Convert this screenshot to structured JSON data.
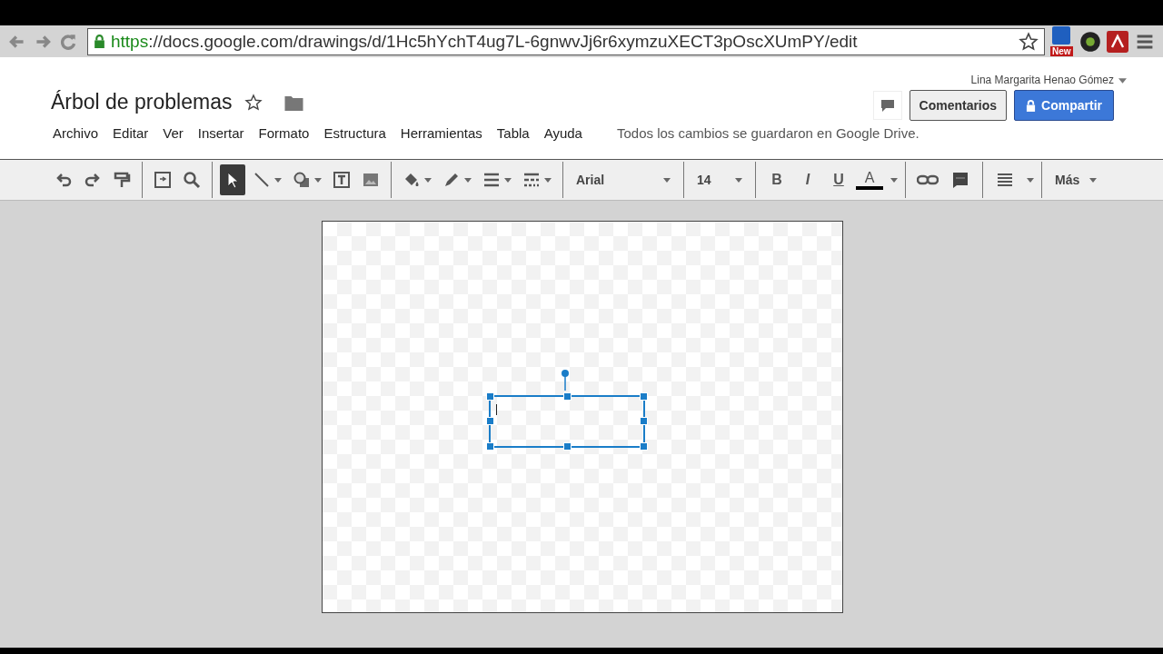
{
  "browser": {
    "url_scheme": "https",
    "url_rest": "://docs.google.com/drawings/d/1Hc5hYchT4ug7L-6gnwvJj6r6xymzuXECT3pOscXUmPY/edit",
    "extension_badge": "New"
  },
  "document": {
    "title": "Árbol de problemas",
    "starred": false
  },
  "user": {
    "name": "Lina Margarita Henao Gómez"
  },
  "menu": [
    "Archivo",
    "Editar",
    "Ver",
    "Insertar",
    "Formato",
    "Estructura",
    "Herramientas",
    "Tabla",
    "Ayuda"
  ],
  "save_status": "Todos los cambios se guardaron en Google Drive.",
  "buttons": {
    "comments": "Comentarios",
    "share": "Compartir"
  },
  "tools": [
    {
      "kind": "undo",
      "selected": false
    },
    {
      "kind": "redo",
      "selected": false
    },
    {
      "kind": "paint-format",
      "selected": false
    },
    {
      "kind": "sep"
    },
    {
      "kind": "zoom-fit",
      "selected": false
    },
    {
      "kind": "zoom",
      "selected": false
    },
    {
      "kind": "sep"
    },
    {
      "kind": "select",
      "selected": true
    },
    {
      "kind": "line",
      "selected": false
    },
    {
      "kind": "shape",
      "selected": false
    },
    {
      "kind": "textbox",
      "selected": false
    },
    {
      "kind": "image",
      "selected": false
    },
    {
      "kind": "sep"
    },
    {
      "kind": "fill",
      "selected": false
    },
    {
      "kind": "pen",
      "selected": false
    },
    {
      "kind": "weight",
      "selected": false
    },
    {
      "kind": "dash",
      "selected": false
    }
  ],
  "format": {
    "font": "Arial",
    "size": "14",
    "bold": "B",
    "italic": "I",
    "underline": "U",
    "text_color": "A",
    "more": "Más"
  }
}
